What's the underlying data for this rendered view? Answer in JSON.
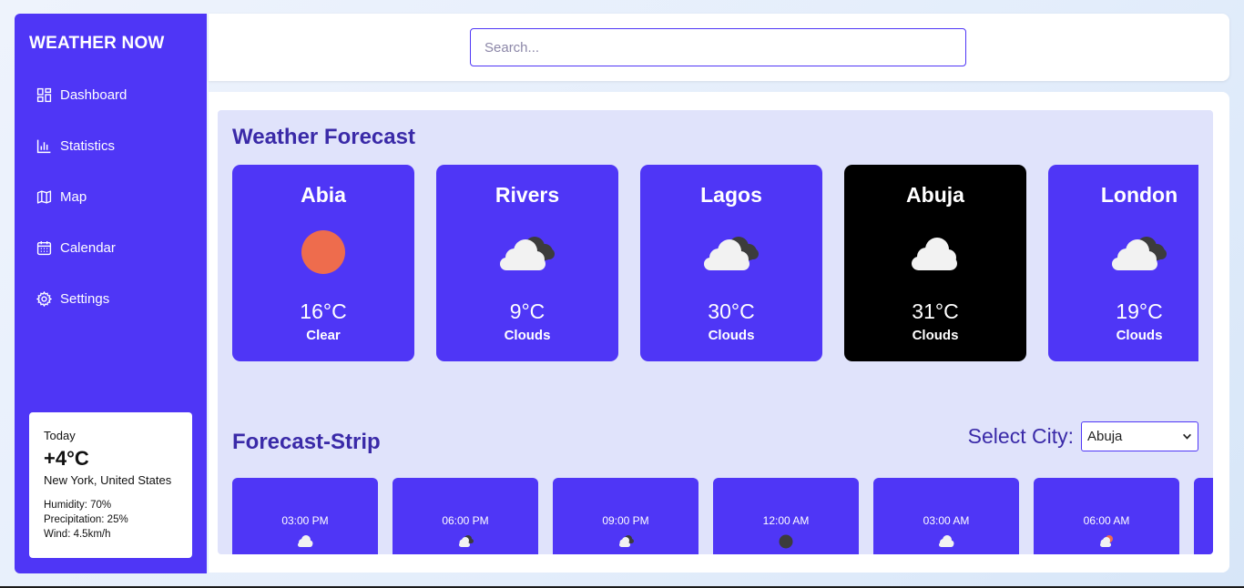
{
  "app": {
    "title": "WEATHER NOW"
  },
  "sidebar": {
    "items": [
      {
        "label": "Dashboard",
        "icon": "dashboard-icon"
      },
      {
        "label": "Statistics",
        "icon": "bar-chart-icon"
      },
      {
        "label": "Map",
        "icon": "map-icon"
      },
      {
        "label": "Calendar",
        "icon": "calendar-icon"
      },
      {
        "label": "Settings",
        "icon": "gear-icon"
      }
    ]
  },
  "today": {
    "label": "Today",
    "temp": "+4°C",
    "location": "New York, United States",
    "humidity": "Humidity: 70%",
    "precipitation": "Precipitation: 25%",
    "wind": "Wind: 4.5km/h"
  },
  "search": {
    "placeholder": "Search..."
  },
  "forecast": {
    "title": "Weather Forecast",
    "cards": [
      {
        "city": "Abia",
        "temp": "16°C",
        "condition": "Clear",
        "icon": "sun-icon"
      },
      {
        "city": "Rivers",
        "temp": "9°C",
        "condition": "Clouds",
        "icon": "broken-clouds-icon"
      },
      {
        "city": "Lagos",
        "temp": "30°C",
        "condition": "Clouds",
        "icon": "broken-clouds-icon"
      },
      {
        "city": "Abuja",
        "temp": "31°C",
        "condition": "Clouds",
        "icon": "cloud-icon",
        "active": true
      },
      {
        "city": "London",
        "temp": "19°C",
        "condition": "Clouds",
        "icon": "broken-clouds-icon"
      }
    ]
  },
  "strip": {
    "title": "Forecast-Strip",
    "select_label": "Select City:",
    "selected_city": "Abuja",
    "slots": [
      {
        "time": "03:00 PM",
        "icon": "cloud-icon"
      },
      {
        "time": "06:00 PM",
        "icon": "broken-clouds-icon"
      },
      {
        "time": "09:00 PM",
        "icon": "broken-clouds-icon"
      },
      {
        "time": "12:00 AM",
        "icon": "dark-cloud-icon"
      },
      {
        "time": "03:00 AM",
        "icon": "cloud-icon"
      },
      {
        "time": "06:00 AM",
        "icon": "few-clouds-day-icon"
      }
    ]
  },
  "colors": {
    "accent": "#4f36f6",
    "active_card": "#000000",
    "panel_bg": "#e0e3fb",
    "title_text": "#3a2aa8",
    "sun": "#ee6c4d"
  }
}
